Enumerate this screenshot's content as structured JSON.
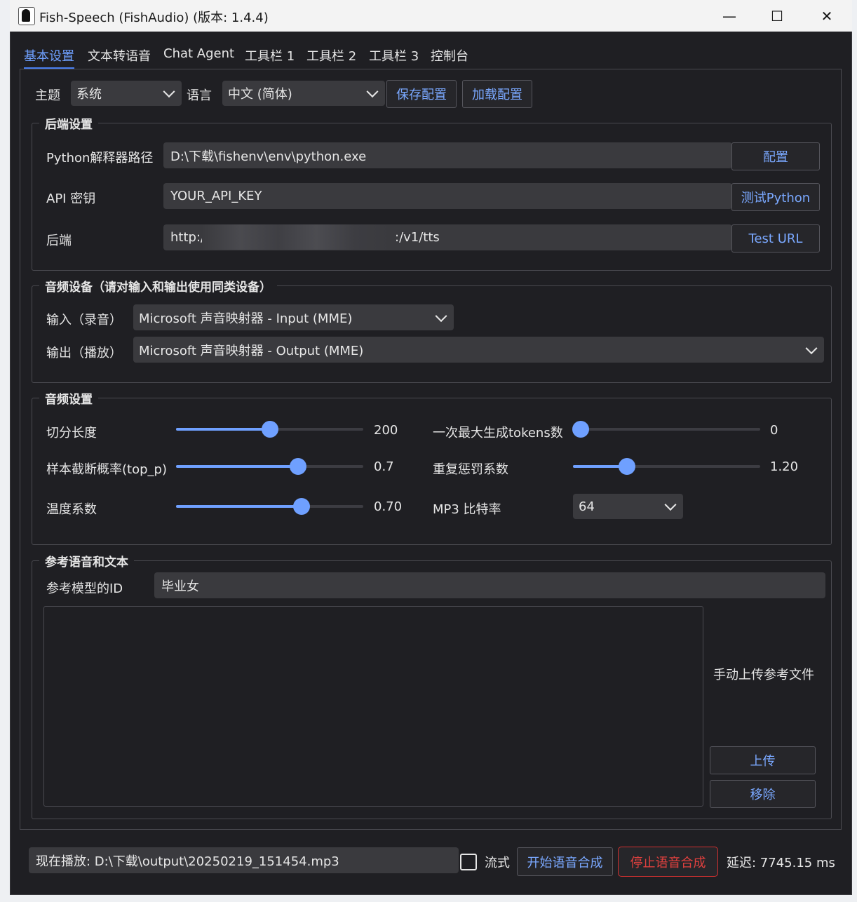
{
  "window": {
    "title": "Fish-Speech (FishAudio) (版本: 1.4.4)",
    "minimize": "—",
    "maximize": "☐",
    "close": "✕"
  },
  "tabs": [
    "基本设置",
    "文本转语音",
    "Chat Agent",
    "工具栏 1",
    "工具栏 2",
    "工具栏 3",
    "控制台"
  ],
  "top": {
    "theme_label": "主题",
    "theme_value": "系统",
    "language_label": "语言",
    "language_value": "中文 (简体)",
    "save_config": "保存配置",
    "load_config": "加载配置"
  },
  "backend": {
    "title": "后端设置",
    "python_label": "Python解释器路径",
    "python_value": "D:\\下载\\fishenv\\env\\python.exe",
    "configure": "配置",
    "api_label": "API 密钥",
    "api_value": "YOUR_API_KEY",
    "test_python": "测试Python",
    "backend_label": "后端",
    "backend_prefix": "http:/",
    "backend_suffix": ":/v1/tts",
    "test_url": "Test URL"
  },
  "audio_device": {
    "title": "音频设备（请对输入和输出使用同类设备）",
    "input_label": "输入（录音）",
    "input_value": "Microsoft 声音映射器 - Input (MME)",
    "output_label": "输出（播放）",
    "output_value": "Microsoft 声音映射器 - Output (MME)"
  },
  "audio_settings": {
    "title": "音频设置",
    "chunk_label": "切分长度",
    "chunk_value": "200",
    "chunk_level": 0.5,
    "top_p_label": "样本截断概率(top_p)",
    "top_p_value": "0.7",
    "top_p_level": 0.65,
    "temp_label": "温度系数",
    "temp_value": "0.70",
    "temp_level": 0.67,
    "max_tokens_label": "一次最大生成tokens数",
    "max_tokens_value": "0",
    "max_tokens_level": 0.04,
    "rep_label": "重复惩罚系数",
    "rep_value": "1.20",
    "rep_level": 0.29,
    "mp3_label": "MP3 比特率",
    "mp3_value": "64"
  },
  "reference": {
    "title": "参考语音和文本",
    "id_label": "参考模型的ID",
    "id_value": "毕业女",
    "upload_hint": "手动上传参考文件",
    "upload": "上传",
    "remove": "移除"
  },
  "bottom": {
    "now_playing": "现在播放: D:\\下载\\output\\20250219_151454.mp3",
    "stream_label": "流式",
    "start": "开始语音合成",
    "stop": "停止语音合成",
    "latency": "延迟: 7745.15 ms"
  }
}
